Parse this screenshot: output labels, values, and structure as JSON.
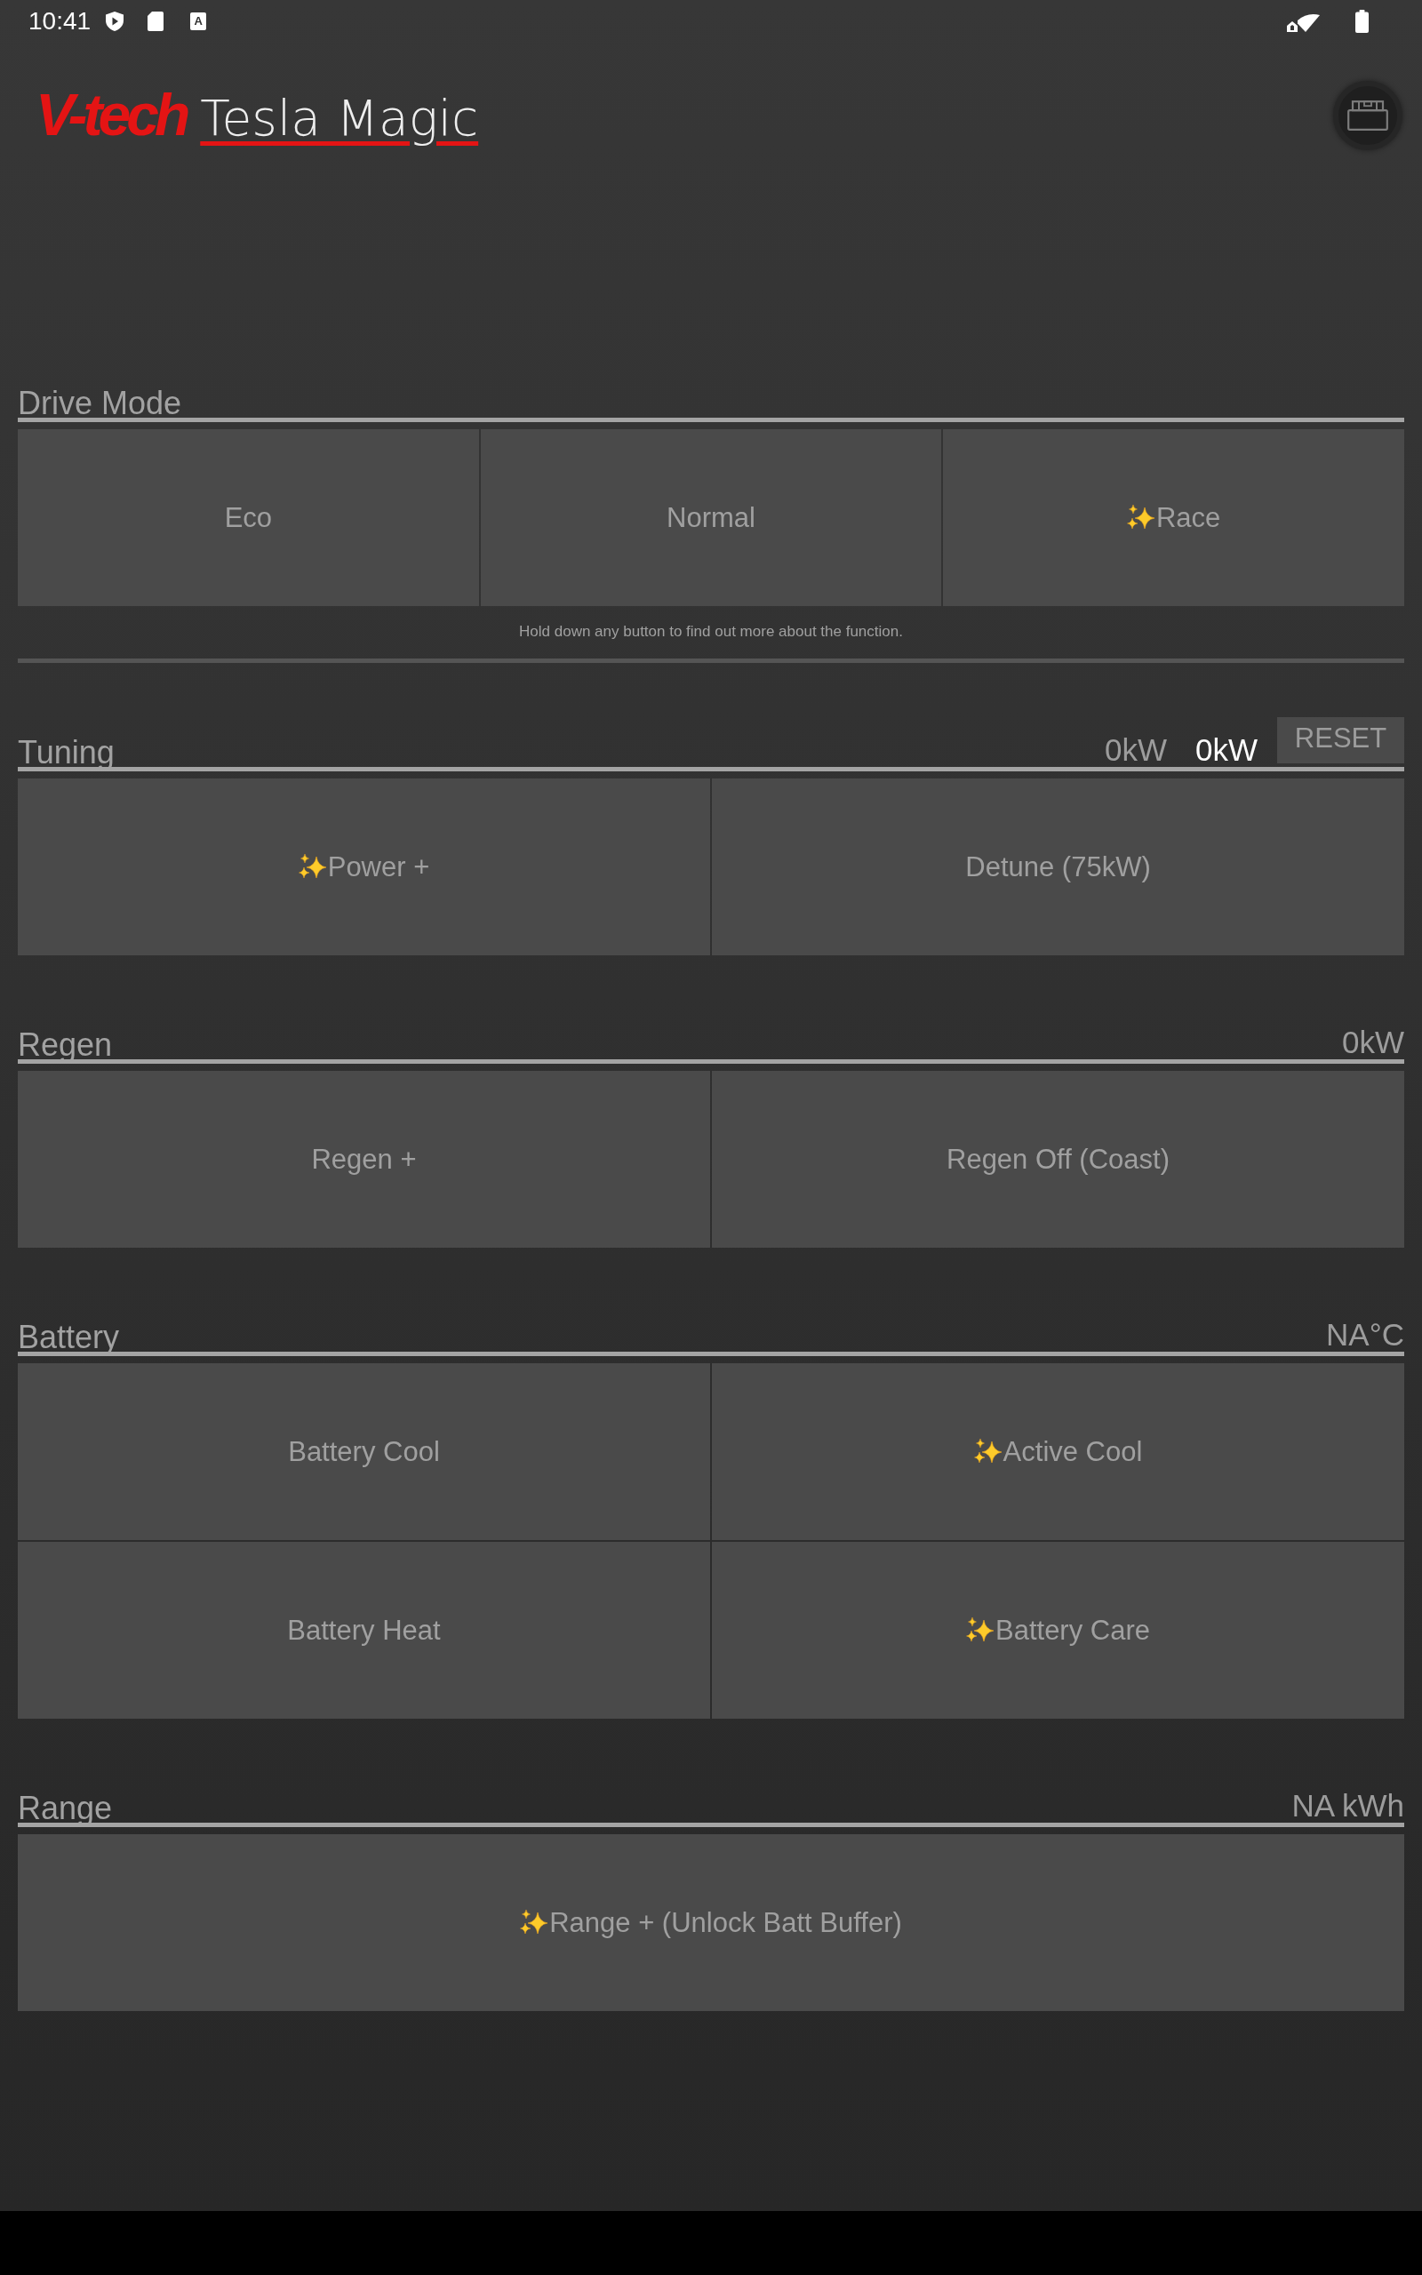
{
  "status_bar": {
    "time": "10:41",
    "notification_letter": "A"
  },
  "header": {
    "brand": "V-tech",
    "title": "Tesla Magic"
  },
  "sections": [
    {
      "title": "Drive Mode",
      "rows": [
        [
          {
            "label": "Eco",
            "sparkle": false
          },
          {
            "label": "Normal",
            "sparkle": false
          },
          {
            "label": "Race",
            "sparkle": true
          }
        ]
      ],
      "hint": "Hold down any button to find out more about the function."
    },
    {
      "title": "Tuning",
      "readings": [
        {
          "text": "0kW",
          "highlighted": false
        },
        {
          "text": "0kW",
          "highlighted": true
        }
      ],
      "reset_button": "RESET",
      "rows": [
        [
          {
            "label": "Power +",
            "sparkle": true
          },
          {
            "label": "Detune (75kW)",
            "sparkle": false
          }
        ]
      ]
    },
    {
      "title": "Regen",
      "readings": [
        {
          "text": "0kW",
          "highlighted": false
        }
      ],
      "rows": [
        [
          {
            "label": "Regen +",
            "sparkle": false
          },
          {
            "label": "Regen Off (Coast)",
            "sparkle": false
          }
        ]
      ]
    },
    {
      "title": "Battery",
      "readings": [
        {
          "text": "NA°C",
          "highlighted": false
        }
      ],
      "rows": [
        [
          {
            "label": "Battery Cool",
            "sparkle": false
          },
          {
            "label": "Active Cool",
            "sparkle": true
          }
        ],
        [
          {
            "label": "Battery Heat",
            "sparkle": false
          },
          {
            "label": "Battery Care",
            "sparkle": true
          }
        ]
      ]
    },
    {
      "title": "Range",
      "readings": [
        {
          "text": "NA kWh",
          "highlighted": false
        }
      ],
      "rows": [
        [
          {
            "label": "Range + (Unlock Batt Buffer)",
            "sparkle": true
          }
        ]
      ]
    }
  ]
}
